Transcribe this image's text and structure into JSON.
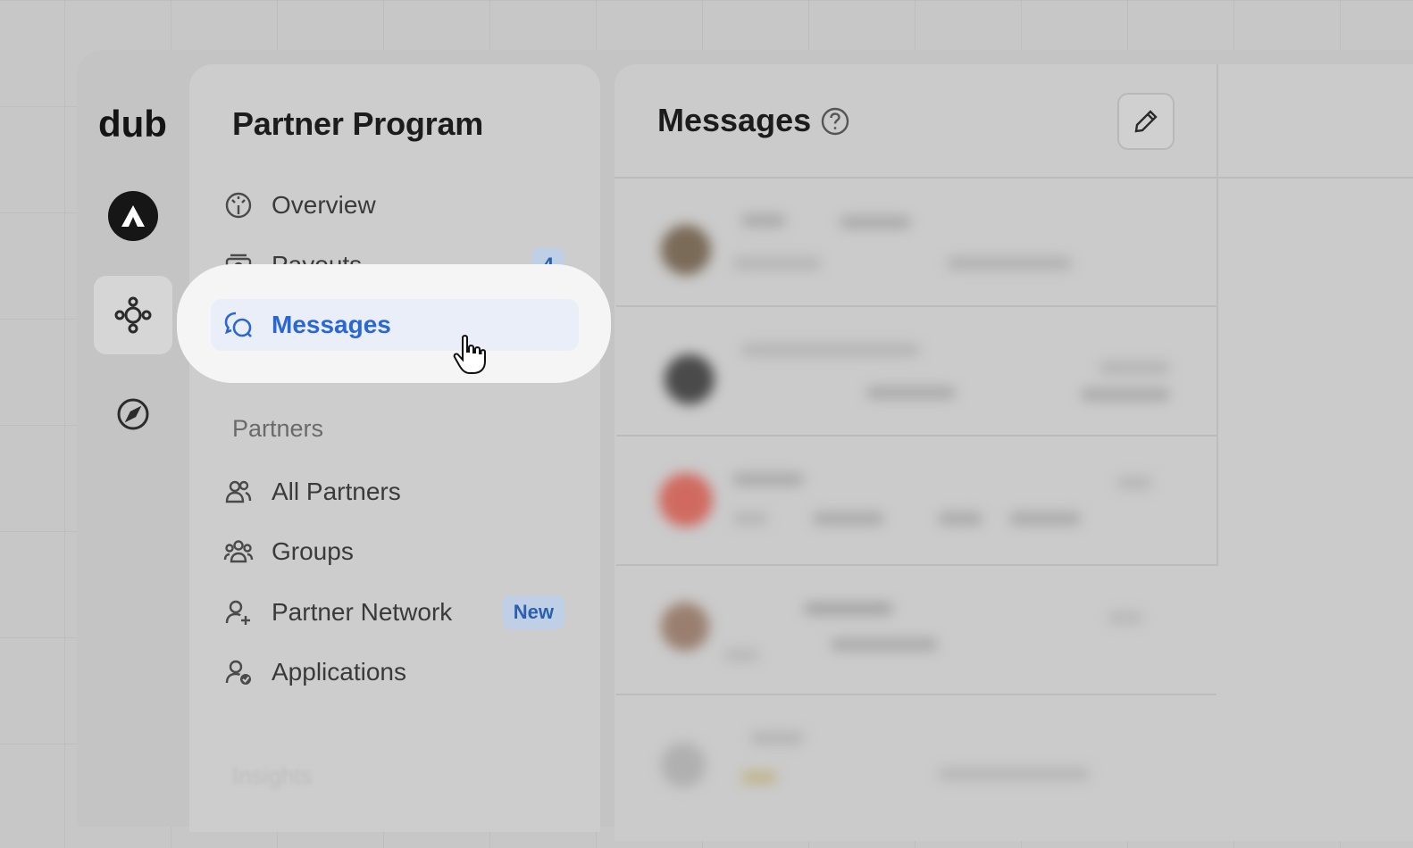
{
  "brand": {
    "logo_text": "dub"
  },
  "rail": {
    "items": [
      {
        "name": "workspace-avatar"
      },
      {
        "name": "programs-icon",
        "active": true
      },
      {
        "name": "compass-icon"
      }
    ]
  },
  "sidebar": {
    "title": "Partner Program",
    "primary": [
      {
        "label": "Overview",
        "icon": "overview-gauge-icon"
      },
      {
        "label": "Payouts",
        "icon": "payouts-icon",
        "badge": "4"
      },
      {
        "label": "Messages",
        "icon": "messages-icon",
        "active": true
      }
    ],
    "partners_section": {
      "heading": "Partners",
      "items": [
        {
          "label": "All Partners",
          "icon": "users-icon"
        },
        {
          "label": "Groups",
          "icon": "groups-icon"
        },
        {
          "label": "Partner Network",
          "icon": "user-plus-icon",
          "badge": "New"
        },
        {
          "label": "Applications",
          "icon": "user-check-icon"
        }
      ]
    },
    "insights_heading": "Insights"
  },
  "main": {
    "title": "Messages",
    "help_icon": "help-circle-icon",
    "compose_icon": "pencil-icon"
  },
  "colors": {
    "accent": "#2a67d6",
    "badge_bg": "#bfd0e6",
    "active_bg": "#e9eef9"
  }
}
